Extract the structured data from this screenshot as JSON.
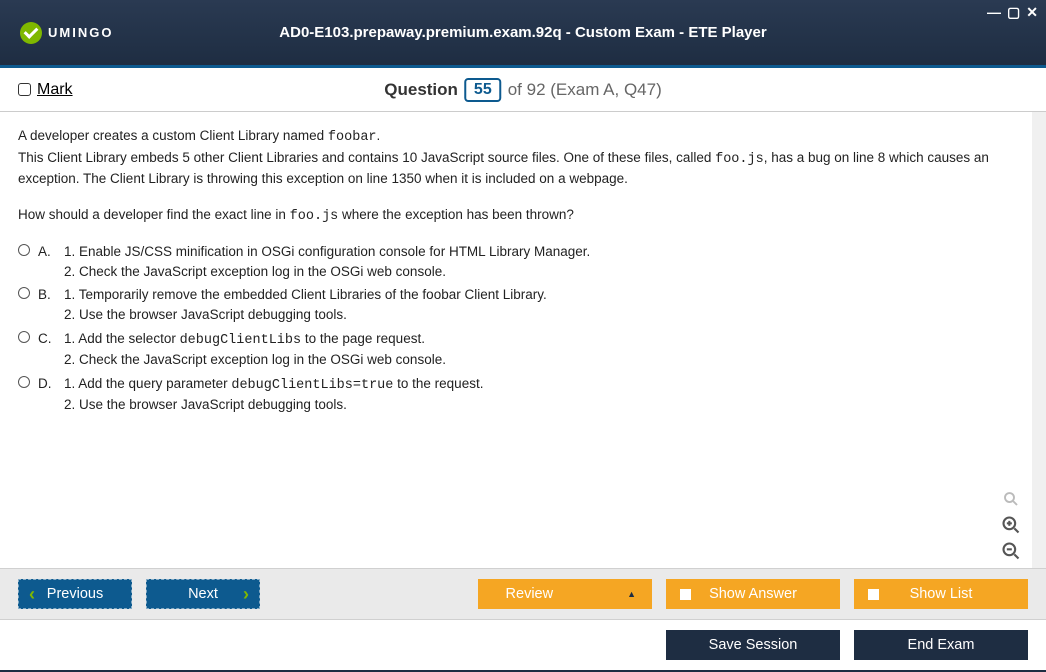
{
  "window": {
    "logo_text": "UMINGO",
    "title": "AD0-E103.prepaway.premium.exam.92q - Custom Exam - ETE Player",
    "min": "—",
    "max": "▢",
    "close": "✕"
  },
  "header": {
    "mark_label": "Mark",
    "q_label": "Question",
    "q_num": "55",
    "q_rest": "of 92 (Exam A, Q47)"
  },
  "question": {
    "intro1a": "A developer creates a custom Client Library named ",
    "intro1b": "foobar",
    "intro1c": ".",
    "intro2a": "This Client Library embeds 5 other Client Libraries and contains 10 JavaScript source files. One of these files, called ",
    "intro2b": "foo.js",
    "intro2c": ", has a bug on line 8 which causes an exception. The Client Library is throwing this exception on line 1350 when it is included on a webpage.",
    "prompt_a": "How should a developer find the exact line in ",
    "prompt_b": "foo.js",
    "prompt_c": " where the exception has been thrown?",
    "options": [
      {
        "letter": "A.",
        "l1": "1. Enable JS/CSS minification in OSGi configuration console for HTML Library Manager.",
        "l2": "2. Check the JavaScript exception log in the OSGi web console."
      },
      {
        "letter": "B.",
        "l1": "1. Temporarily remove the embedded Client Libraries of the foobar Client Library.",
        "l2": "2. Use the browser JavaScript debugging tools."
      },
      {
        "letter": "C.",
        "l1_a": "1. Add the selector ",
        "l1_b": "debugClientLibs",
        "l1_c": " to the page request.",
        "l2": "2. Check the JavaScript exception log in the OSGi web console."
      },
      {
        "letter": "D.",
        "l1_a": "1. Add the query parameter ",
        "l1_b": "debugClientLibs=true",
        "l1_c": " to the request.",
        "l2": "2. Use the browser JavaScript debugging tools."
      }
    ]
  },
  "buttons": {
    "previous": "Previous",
    "next": "Next",
    "review": "Review",
    "show_answer": "Show Answer",
    "show_list": "Show List",
    "save_session": "Save Session",
    "end_exam": "End Exam"
  }
}
